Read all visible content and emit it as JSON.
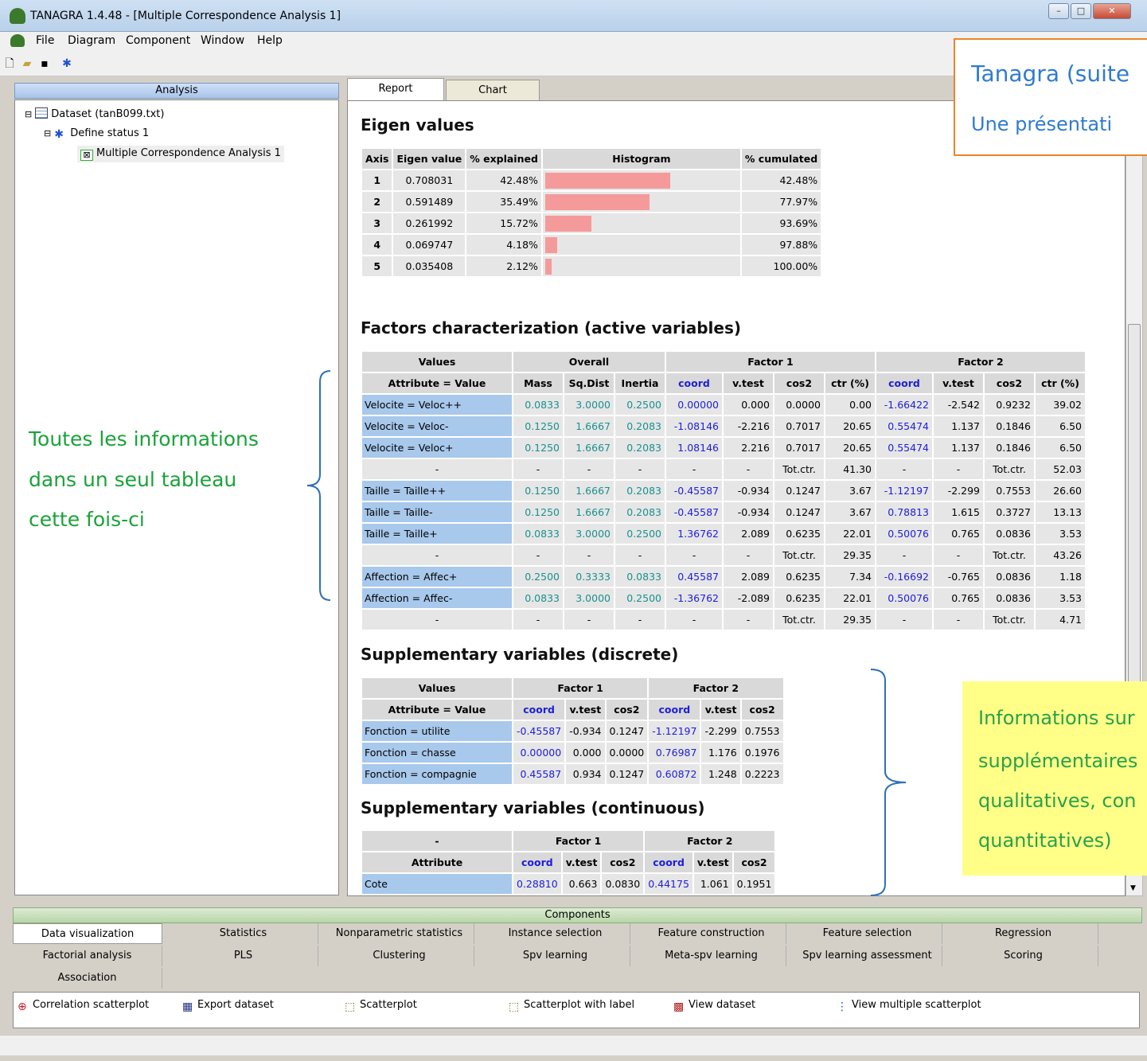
{
  "window": {
    "title": "TANAGRA 1.4.48 - [Multiple Correspondence Analysis 1]"
  },
  "menu": [
    "File",
    "Diagram",
    "Component",
    "Window",
    "Help"
  ],
  "analysis_panel": {
    "header": "Analysis",
    "tree": [
      {
        "label": "Dataset (tanB099.txt)",
        "icon": "dataset-icon"
      },
      {
        "label": "Define status 1",
        "icon": "define-status-icon"
      },
      {
        "label": "Multiple Correspondence Analysis 1",
        "icon": "mca-icon"
      }
    ]
  },
  "report_tabs": [
    "Report",
    "Chart"
  ],
  "report": {
    "eigen": {
      "title": "Eigen values",
      "headers": [
        "Axis",
        "Eigen value",
        "% explained",
        "Histogram",
        "% cumulated"
      ],
      "rows": [
        {
          "axis": "1",
          "eigen": "0.708031",
          "explained": "42.48%",
          "pct": 42.48,
          "cumulated": "42.48%"
        },
        {
          "axis": "2",
          "eigen": "0.591489",
          "explained": "35.49%",
          "pct": 35.49,
          "cumulated": "77.97%"
        },
        {
          "axis": "3",
          "eigen": "0.261992",
          "explained": "15.72%",
          "pct": 15.72,
          "cumulated": "93.69%"
        },
        {
          "axis": "4",
          "eigen": "0.069747",
          "explained": "4.18%",
          "pct": 4.18,
          "cumulated": "97.88%"
        },
        {
          "axis": "5",
          "eigen": "0.035408",
          "explained": "2.12%",
          "pct": 2.12,
          "cumulated": "100.00%"
        }
      ]
    },
    "factors": {
      "title": "Factors characterization (active variables)",
      "group_headers": [
        "Values",
        "Overall",
        "Factor 1",
        "Factor 2"
      ],
      "headers": [
        "Attribute = Value",
        "Mass",
        "Sq.Dist",
        "Inertia",
        "coord",
        "v.test",
        "cos2",
        "ctr (%)",
        "coord",
        "v.test",
        "cos2",
        "ctr (%)"
      ],
      "rows": [
        [
          "Velocite = Veloc++",
          "0.0833",
          "3.0000",
          "0.2500",
          "0.00000",
          "0.000",
          "0.0000",
          "0.00",
          "-1.66422",
          "-2.542",
          "0.9232",
          "39.02"
        ],
        [
          "Velocite = Veloc-",
          "0.1250",
          "1.6667",
          "0.2083",
          "-1.08146",
          "-2.216",
          "0.7017",
          "20.65",
          "0.55474",
          "1.137",
          "0.1846",
          "6.50"
        ],
        [
          "Velocite = Veloc+",
          "0.1250",
          "1.6667",
          "0.2083",
          "1.08146",
          "2.216",
          "0.7017",
          "20.65",
          "0.55474",
          "1.137",
          "0.1846",
          "6.50"
        ],
        [
          "-",
          "-",
          "-",
          "-",
          "-",
          "-",
          "Tot.ctr.",
          "41.30",
          "-",
          "-",
          "Tot.ctr.",
          "52.03"
        ],
        [
          "Taille = Taille++",
          "0.1250",
          "1.6667",
          "0.2083",
          "-0.45587",
          "-0.934",
          "0.1247",
          "3.67",
          "-1.12197",
          "-2.299",
          "0.7553",
          "26.60"
        ],
        [
          "Taille = Taille-",
          "0.1250",
          "1.6667",
          "0.2083",
          "-0.45587",
          "-0.934",
          "0.1247",
          "3.67",
          "0.78813",
          "1.615",
          "0.3727",
          "13.13"
        ],
        [
          "Taille = Taille+",
          "0.0833",
          "3.0000",
          "0.2500",
          "1.36762",
          "2.089",
          "0.6235",
          "22.01",
          "0.50076",
          "0.765",
          "0.0836",
          "3.53"
        ],
        [
          "-",
          "-",
          "-",
          "-",
          "-",
          "-",
          "Tot.ctr.",
          "29.35",
          "-",
          "-",
          "Tot.ctr.",
          "43.26"
        ],
        [
          "Affection = Affec+",
          "0.2500",
          "0.3333",
          "0.0833",
          "0.45587",
          "2.089",
          "0.6235",
          "7.34",
          "-0.16692",
          "-0.765",
          "0.0836",
          "1.18"
        ],
        [
          "Affection = Affec-",
          "0.0833",
          "3.0000",
          "0.2500",
          "-1.36762",
          "-2.089",
          "0.6235",
          "22.01",
          "0.50076",
          "0.765",
          "0.0836",
          "3.53"
        ],
        [
          "-",
          "-",
          "-",
          "-",
          "-",
          "-",
          "Tot.ctr.",
          "29.35",
          "-",
          "-",
          "Tot.ctr.",
          "4.71"
        ]
      ]
    },
    "supp_discrete": {
      "title": "Supplementary variables (discrete)",
      "group_headers": [
        "Values",
        "Factor 1",
        "Factor 2"
      ],
      "headers": [
        "Attribute = Value",
        "coord",
        "v.test",
        "cos2",
        "coord",
        "v.test",
        "cos2"
      ],
      "rows": [
        [
          "Fonction = utilite",
          "-0.45587",
          "-0.934",
          "0.1247",
          "-1.12197",
          "-2.299",
          "0.7553"
        ],
        [
          "Fonction = chasse",
          "0.00000",
          "0.000",
          "0.0000",
          "0.76987",
          "1.176",
          "0.1976"
        ],
        [
          "Fonction = compagnie",
          "0.45587",
          "0.934",
          "0.1247",
          "0.60872",
          "1.248",
          "0.2223"
        ]
      ]
    },
    "supp_continuous": {
      "title": "Supplementary variables (continuous)",
      "group_headers": [
        "-",
        "Factor 1",
        "Factor 2"
      ],
      "headers": [
        "Attribute",
        "coord",
        "v.test",
        "cos2",
        "coord",
        "v.test",
        "cos2"
      ],
      "rows": [
        [
          "Cote",
          "0.28810",
          "0.663",
          "0.0830",
          "0.44175",
          "1.061",
          "0.1951"
        ]
      ]
    }
  },
  "annotations": {
    "orange": {
      "line1": "Tanagra (suite",
      "line2": "Une présentati"
    },
    "green": [
      "Toutes les informations",
      "dans un seul tableau",
      "cette fois-ci"
    ],
    "yellow": [
      "Informations sur",
      "supplémentaires",
      "qualitatives, con",
      "quantitatives)"
    ]
  },
  "components": {
    "header": "Components",
    "tabs_row1": [
      "Data visualization",
      "Statistics",
      "Nonparametric statistics",
      "Instance selection",
      "Feature construction",
      "Feature selection",
      "Regression"
    ],
    "tabs_row2": [
      "Factorial analysis",
      "PLS",
      "Clustering",
      "Spv learning",
      "Meta-spv learning",
      "Spv learning assessment",
      "Scoring"
    ],
    "tabs_row3": [
      "Association"
    ],
    "items": [
      {
        "label": "Correlation scatterplot",
        "icon": "correlation-scatterplot-icon"
      },
      {
        "label": "Export dataset",
        "icon": "export-dataset-icon"
      },
      {
        "label": "Scatterplot",
        "icon": "scatterplot-icon"
      },
      {
        "label": "Scatterplot with label",
        "icon": "scatterplot-label-icon"
      },
      {
        "label": "View dataset",
        "icon": "view-dataset-icon"
      },
      {
        "label": "View multiple scatterplot",
        "icon": "view-multiple-scatterplot-icon"
      }
    ]
  },
  "colors": {
    "accent_blue": "#2020d8",
    "teal_values": "#1a9090",
    "label_cell": "#a8c8ec",
    "histogram_bar": "#f59a9a",
    "orange_border": "#e8862a",
    "green_note": "#1aa33a",
    "yellow_note": "#ffff88"
  }
}
